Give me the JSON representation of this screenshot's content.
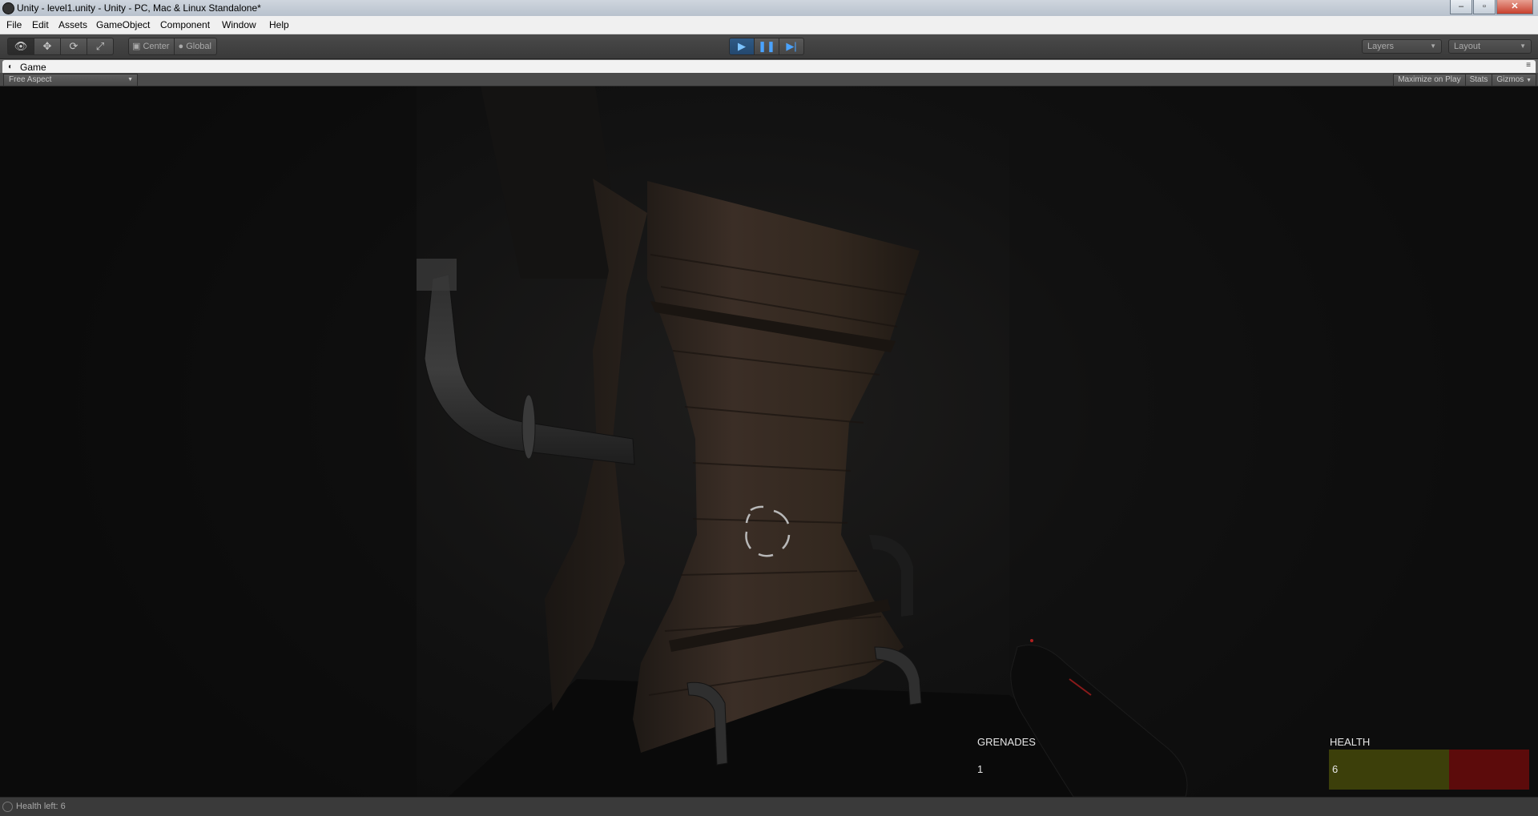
{
  "window": {
    "title": "Unity - level1.unity - Unity - PC, Mac & Linux Standalone*",
    "minimize": "–",
    "maximize": "▫",
    "close": "✕"
  },
  "menu": [
    "File",
    "Edit",
    "Assets",
    "GameObject",
    "Component",
    "Window",
    "Help"
  ],
  "toolbar": {
    "pivot_mode": "Center",
    "pivot_rotation": "Global",
    "layers": "Layers",
    "layout": "Layout",
    "play_state": "playing"
  },
  "game_view": {
    "tab_label": "Game",
    "aspect": "Free Aspect",
    "maximize_on_play": "Maximize on Play",
    "stats": "Stats",
    "gizmos": "Gizmos"
  },
  "hud": {
    "grenades_label": "GRENADES",
    "grenades_value": "1",
    "health_label": "HEALTH",
    "health_value": "6",
    "health_fraction": 0.6,
    "health_color": "#3c3f0a",
    "health_bg_color": "#5c0b0b"
  },
  "status": {
    "text": "Health left: 6"
  },
  "colors": {
    "play_accent": "#4aa3ff",
    "editor_dark": "#3a3a3a"
  }
}
